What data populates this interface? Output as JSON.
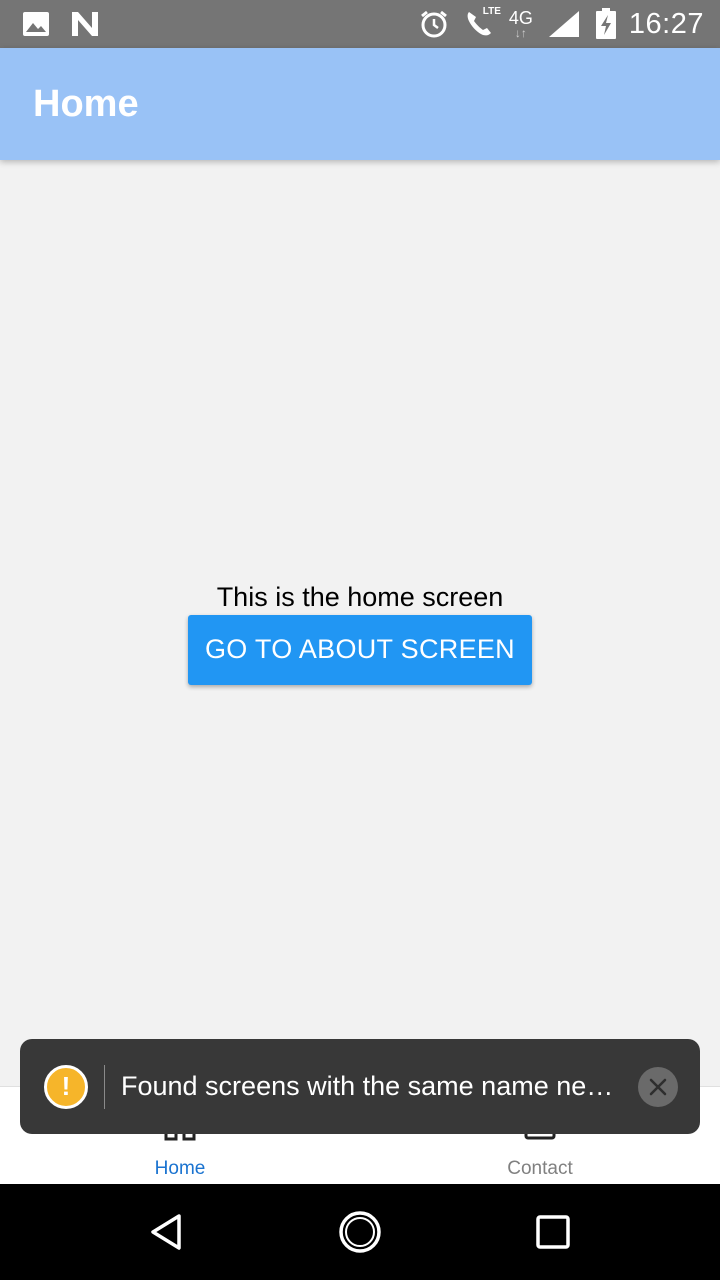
{
  "status_bar": {
    "time": "16:27",
    "left_icons": [
      "image-icon",
      "n-logo-icon"
    ],
    "right_icons": [
      "alarm-icon",
      "lte-call-icon",
      "4g-data-icon",
      "signal-icon",
      "battery-charging-icon"
    ],
    "lte_label": "LTE",
    "network_label": "4G"
  },
  "app_bar": {
    "title": "Home",
    "color": "#99c2f6"
  },
  "content": {
    "message": "This is the home screen",
    "button_label": "GO TO ABOUT SCREEN",
    "button_color": "#2196f3"
  },
  "toast": {
    "icon": "warning-icon",
    "icon_glyph": "!",
    "message": "Found screens with the same name ne…",
    "close_icon": "close-icon"
  },
  "tab_bar": {
    "tabs": [
      {
        "label": "Home",
        "icon": "home-icon",
        "active": true
      },
      {
        "label": "Contact",
        "icon": "contact-icon",
        "active": false
      }
    ],
    "active_color": "#1a73d0"
  },
  "nav_bar": {
    "buttons": [
      "back-icon",
      "home-circle-icon",
      "recents-icon"
    ]
  }
}
